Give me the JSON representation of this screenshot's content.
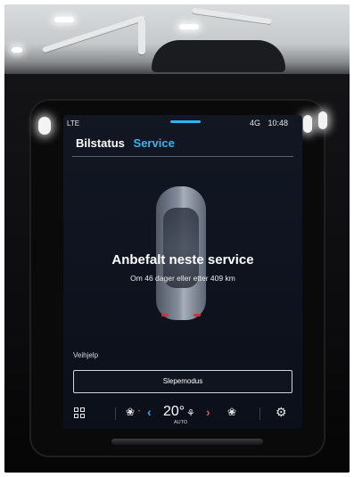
{
  "status_bar": {
    "network_left": "LTE",
    "network_right": "4G",
    "time": "10:48"
  },
  "tabs": {
    "car_status": "Bilstatus",
    "service": "Service"
  },
  "main": {
    "headline": "Anbefalt neste service",
    "subline": "Om 46 dager eller etter 409 km"
  },
  "roadside": {
    "label": "Veihjelp",
    "tow_button": "Slepemodus"
  },
  "climate": {
    "temperature": "20°",
    "mode": "AUTO"
  },
  "icons": {
    "apps": "grid-icon",
    "seat_heat": "seat-heat-icon",
    "fan": "fan-icon",
    "settings": "gear-icon"
  },
  "colors": {
    "accent_blue": "#37b3f0",
    "accent_red": "#ea4c5d",
    "screen_bg": "#0f1420"
  }
}
